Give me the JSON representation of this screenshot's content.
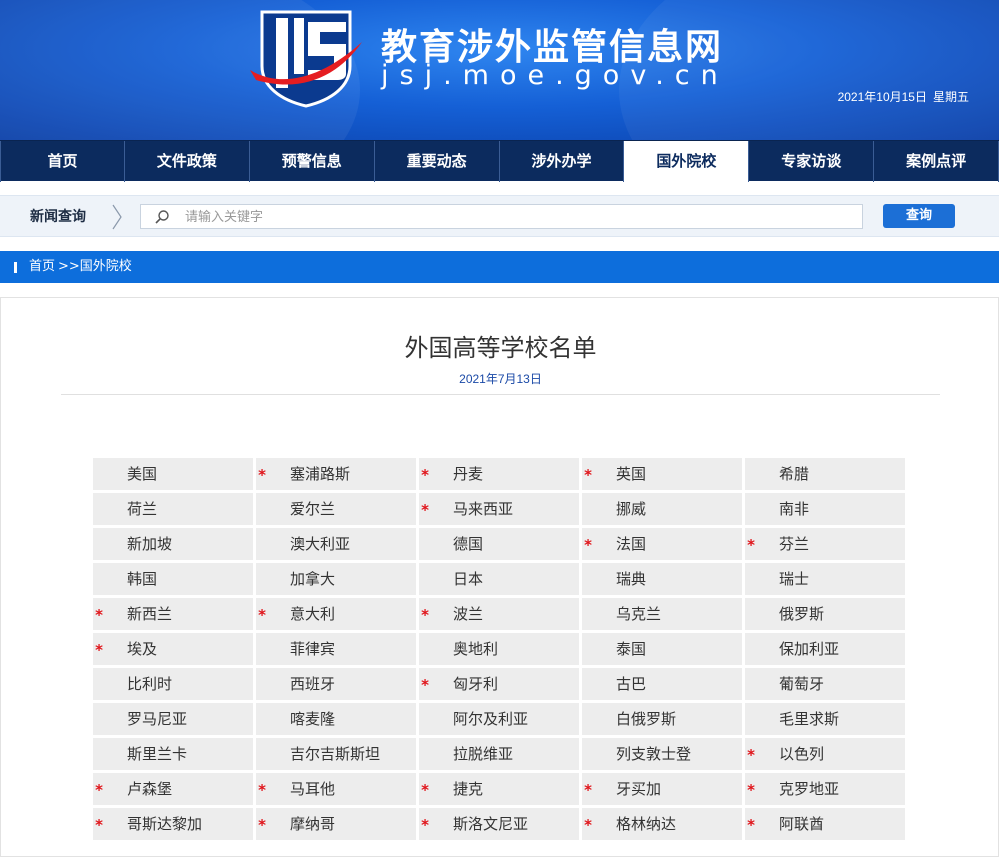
{
  "header": {
    "site_title": "教育涉外监管信息网",
    "site_url": "jsj.moe.gov.cn",
    "date": "2021年10月15日",
    "weekday": "星期五"
  },
  "nav": [
    {
      "label": "首页",
      "active": false
    },
    {
      "label": "文件政策",
      "active": false
    },
    {
      "label": "预警信息",
      "active": false
    },
    {
      "label": "重要动态",
      "active": false
    },
    {
      "label": "涉外办学",
      "active": false
    },
    {
      "label": "国外院校",
      "active": true
    },
    {
      "label": "专家访谈",
      "active": false
    },
    {
      "label": "案例点评",
      "active": false
    }
  ],
  "search": {
    "label": "新闻查询",
    "placeholder": "请输入关键字",
    "value": "",
    "button": "查询"
  },
  "breadcrumb": {
    "home": "首页",
    "current": ">>国外院校"
  },
  "article": {
    "title": "外国高等学校名单",
    "date": "2021年7月13日"
  },
  "countries": [
    [
      {
        "name": "美国",
        "star": false
      },
      {
        "name": "塞浦路斯",
        "star": true
      },
      {
        "name": "丹麦",
        "star": true
      },
      {
        "name": "英国",
        "star": true
      },
      {
        "name": "希腊",
        "star": false
      }
    ],
    [
      {
        "name": "荷兰",
        "star": false
      },
      {
        "name": "爱尔兰",
        "star": false
      },
      {
        "name": "马来西亚",
        "star": true
      },
      {
        "name": "挪威",
        "star": false
      },
      {
        "name": "南非",
        "star": false
      }
    ],
    [
      {
        "name": "新加坡",
        "star": false
      },
      {
        "name": "澳大利亚",
        "star": false
      },
      {
        "name": "德国",
        "star": false
      },
      {
        "name": "法国",
        "star": true
      },
      {
        "name": "芬兰",
        "star": true
      }
    ],
    [
      {
        "name": "韩国",
        "star": false
      },
      {
        "name": "加拿大",
        "star": false
      },
      {
        "name": "日本",
        "star": false
      },
      {
        "name": "瑞典",
        "star": false
      },
      {
        "name": "瑞士",
        "star": false
      }
    ],
    [
      {
        "name": "新西兰",
        "star": true
      },
      {
        "name": "意大利",
        "star": true
      },
      {
        "name": "波兰",
        "star": true
      },
      {
        "name": "乌克兰",
        "star": false
      },
      {
        "name": "俄罗斯",
        "star": false
      }
    ],
    [
      {
        "name": "埃及",
        "star": true
      },
      {
        "name": "菲律宾",
        "star": false
      },
      {
        "name": "奥地利",
        "star": false
      },
      {
        "name": "泰国",
        "star": false
      },
      {
        "name": "保加利亚",
        "star": false
      }
    ],
    [
      {
        "name": "比利时",
        "star": false
      },
      {
        "name": "西班牙",
        "star": false
      },
      {
        "name": "匈牙利",
        "star": true
      },
      {
        "name": "古巴",
        "star": false
      },
      {
        "name": "葡萄牙",
        "star": false
      }
    ],
    [
      {
        "name": "罗马尼亚",
        "star": false
      },
      {
        "name": "喀麦隆",
        "star": false
      },
      {
        "name": "阿尔及利亚",
        "star": false
      },
      {
        "name": "白俄罗斯",
        "star": false
      },
      {
        "name": "毛里求斯",
        "star": false
      }
    ],
    [
      {
        "name": "斯里兰卡",
        "star": false
      },
      {
        "name": "吉尔吉斯斯坦",
        "star": false
      },
      {
        "name": "拉脱维亚",
        "star": false
      },
      {
        "name": "列支敦士登",
        "star": false
      },
      {
        "name": "以色列",
        "star": true
      }
    ],
    [
      {
        "name": "卢森堡",
        "star": true
      },
      {
        "name": "马耳他",
        "star": true
      },
      {
        "name": "捷克",
        "star": true
      },
      {
        "name": "牙买加",
        "star": true
      },
      {
        "name": "克罗地亚",
        "star": true
      }
    ],
    [
      {
        "name": "哥斯达黎加",
        "star": true
      },
      {
        "name": "摩纳哥",
        "star": true
      },
      {
        "name": "斯洛文尼亚",
        "star": true
      },
      {
        "name": "格林纳达",
        "star": true
      },
      {
        "name": "阿联酋",
        "star": true
      }
    ]
  ],
  "star_symbol": "*",
  "colors": {
    "nav_bg": "#0c2b5e",
    "crumb_bg": "#0d6edc",
    "star": "#e0141a",
    "cell_bg": "#ededed"
  }
}
